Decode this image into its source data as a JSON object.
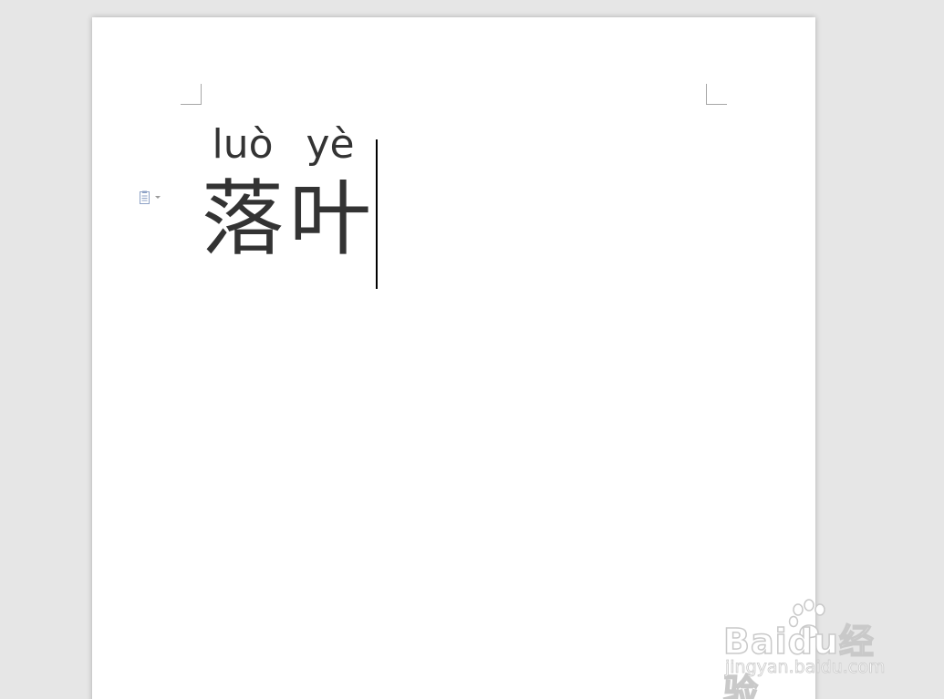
{
  "document": {
    "ruby": [
      {
        "pinyin": "luò",
        "hanzi": "落"
      },
      {
        "pinyin": "yè",
        "hanzi": "叶"
      }
    ]
  },
  "paste_options": {
    "icon": "clipboard-icon",
    "dropdown_icon": "chevron-down-icon"
  },
  "watermark": {
    "logo_text": "Baidu经验",
    "url": "jingyan.baidu.com"
  },
  "colors": {
    "workspace": "#e6e6e6",
    "page": "#ffffff",
    "text": "#333333",
    "margin_mark": "#a6a6a6",
    "paste_icon": "#8ea2c6"
  }
}
